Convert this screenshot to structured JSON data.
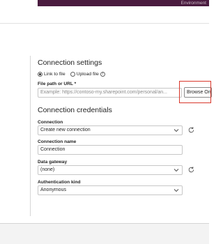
{
  "topbar": {
    "environment_label": "Environment"
  },
  "connection_settings": {
    "title": "Connection settings",
    "radio_link": "Link to file",
    "radio_upload": "Upload file",
    "file_label": "File path or URL *",
    "file_placeholder": "Example: https://contoso-my.sharepoint.com/personal/an...",
    "browse_label": "Browse OneDrive"
  },
  "connection_credentials": {
    "title": "Connection credentials",
    "connection_label": "Connection",
    "connection_value": "Create new connection",
    "name_label": "Connection name",
    "name_value": "Connection",
    "gateway_label": "Data gateway",
    "gateway_value": "(none)",
    "auth_label": "Authentication kind",
    "auth_value": "Anonymous"
  },
  "colors": {
    "accent": "#4a1b3f",
    "highlight": "#d9362a"
  }
}
